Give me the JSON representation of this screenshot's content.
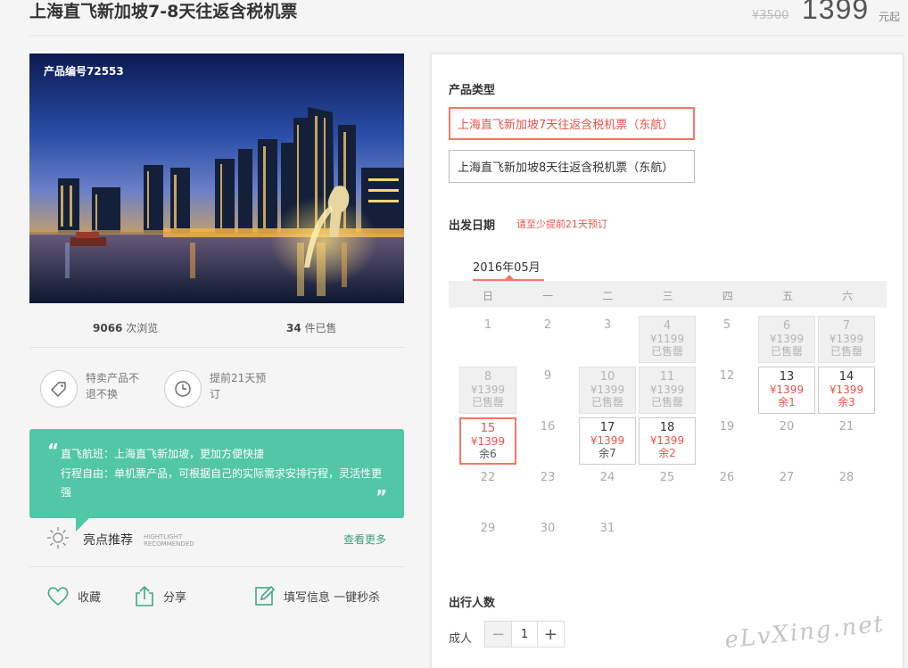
{
  "header": {
    "title": "上海直飞新加坡7-8天往返含税机票",
    "original_price": "¥3500",
    "price": "1399",
    "price_unit": "元起"
  },
  "photo": {
    "product_no": "产品编号72553"
  },
  "stats": {
    "views_num": "9066",
    "views_label": " 次浏览",
    "sold_num": "34",
    "sold_label": " 件已售"
  },
  "features": [
    {
      "icon": "tag-icon",
      "text": "特卖产品不退不换"
    },
    {
      "icon": "clock-icon",
      "text": "提前21天预订"
    }
  ],
  "bubble": {
    "line1": "直飞航班：上海直飞新加坡，更加方便快捷",
    "line2": "行程自由：单机票产品，可根据自己的实际需求安排行程，灵活性更强",
    "open_quote": "“",
    "close_quote": "”"
  },
  "highlight": {
    "title": "亮点推荐",
    "sub1": "HIGHTLIGHT",
    "sub2": "RECOMMENDED",
    "more": "查看更多"
  },
  "actions": {
    "favorite": "收藏",
    "share": "分享",
    "book": "填写信息 一键秒杀"
  },
  "panel": {
    "product_type_label": "产品类型",
    "options": [
      {
        "label": "上海直飞新加坡7天往返含税机票（东航）",
        "selected": true
      },
      {
        "label": "上海直飞新加坡8天往返含税机票（东航）",
        "selected": false
      }
    ],
    "date_label": "出发日期",
    "date_hint": "请至少提前21天预订",
    "month": "2016年05月",
    "weekdays": [
      "日",
      "一",
      "二",
      "三",
      "四",
      "五",
      "六"
    ],
    "days": [
      {
        "d": "1",
        "state": "plain"
      },
      {
        "d": "2",
        "state": "plain"
      },
      {
        "d": "3",
        "state": "plain"
      },
      {
        "d": "4",
        "state": "soldout",
        "price": "¥1199",
        "status": "已售罄"
      },
      {
        "d": "5",
        "state": "plain"
      },
      {
        "d": "6",
        "state": "soldout",
        "price": "¥1399",
        "status": "已售罄"
      },
      {
        "d": "7",
        "state": "soldout",
        "price": "¥1399",
        "status": "已售罄"
      },
      {
        "d": "8",
        "state": "soldout",
        "price": "¥1399",
        "status": "已售罄"
      },
      {
        "d": "9",
        "state": "plain"
      },
      {
        "d": "10",
        "state": "soldout",
        "price": "¥1399",
        "status": "已售罄"
      },
      {
        "d": "11",
        "state": "soldout",
        "price": "¥1399",
        "status": "已售罄"
      },
      {
        "d": "12",
        "state": "plain"
      },
      {
        "d": "13",
        "state": "avail",
        "price": "¥1399",
        "status": "余1",
        "status_color": "red"
      },
      {
        "d": "14",
        "state": "avail",
        "price": "¥1399",
        "status": "余3",
        "status_color": "red"
      },
      {
        "d": "15",
        "state": "selected",
        "price": "¥1399",
        "status": "余6",
        "status_color": "gray"
      },
      {
        "d": "16",
        "state": "plain"
      },
      {
        "d": "17",
        "state": "avail",
        "price": "¥1399",
        "status": "余7",
        "status_color": "gray"
      },
      {
        "d": "18",
        "state": "avail",
        "price": "¥1399",
        "status": "余2",
        "status_color": "red"
      },
      {
        "d": "19",
        "state": "plain"
      },
      {
        "d": "20",
        "state": "plain"
      },
      {
        "d": "21",
        "state": "plain"
      },
      {
        "d": "22",
        "state": "plain"
      },
      {
        "d": "23",
        "state": "plain"
      },
      {
        "d": "24",
        "state": "plain"
      },
      {
        "d": "25",
        "state": "plain"
      },
      {
        "d": "26",
        "state": "plain"
      },
      {
        "d": "27",
        "state": "plain"
      },
      {
        "d": "28",
        "state": "plain"
      },
      {
        "d": "29",
        "state": "plain"
      },
      {
        "d": "30",
        "state": "plain"
      },
      {
        "d": "31",
        "state": "plain"
      }
    ],
    "travelers_label": "出行人数",
    "adult_label": "成人",
    "adult_count": "1"
  },
  "watermark": "eLvXing.net",
  "colors": {
    "accent": "#e8544b",
    "bubble": "#52c7a7",
    "link": "#3c9e80"
  }
}
